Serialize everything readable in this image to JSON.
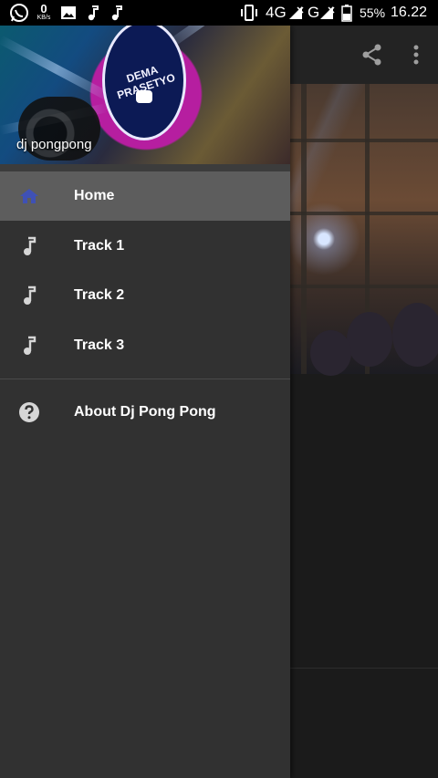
{
  "status_bar": {
    "net_speed_value": "0",
    "net_speed_unit": "KB/s",
    "network_4g": "4G",
    "network_g": "G",
    "battery": "55%",
    "time": "16.22"
  },
  "drawer": {
    "header_title": "dj pongpong",
    "logo_text": "DEMA PRASETYO",
    "items": [
      {
        "label": "Home",
        "icon": "home-icon",
        "active": true
      },
      {
        "label": "Track 1",
        "icon": "music-note-icon",
        "active": false
      },
      {
        "label": "Track 2",
        "icon": "music-note-icon",
        "active": false
      },
      {
        "label": "Track 3",
        "icon": "music-note-icon",
        "active": false
      }
    ],
    "secondary_items": [
      {
        "label": "About Dj Pong Pong",
        "icon": "help-icon"
      }
    ]
  },
  "colors": {
    "drawer_bg": "#313131",
    "active_item_bg": "#5d5d5d",
    "home_icon_accent": "#3f51b5",
    "status_bar_bg": "#000000"
  }
}
